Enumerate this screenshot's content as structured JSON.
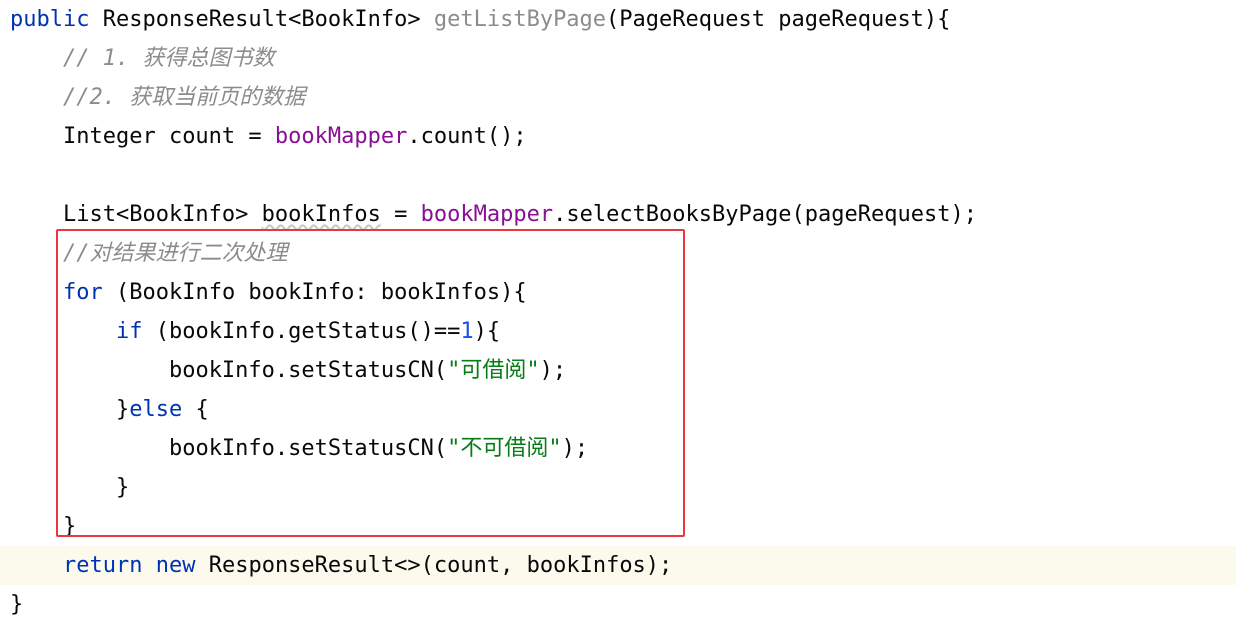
{
  "code": {
    "lines": [
      {
        "indent": "",
        "tokens": [
          {
            "t": "public",
            "c": "kw"
          },
          {
            "t": " ResponseResult<BookInfo> ",
            "c": ""
          },
          {
            "t": "getListByPage",
            "c": "fn"
          },
          {
            "t": "(PageRequest pageRequest){",
            "c": ""
          }
        ]
      },
      {
        "indent": "    ",
        "tokens": [
          {
            "t": "// 1. 获得总图书数",
            "c": "cm"
          }
        ]
      },
      {
        "indent": "    ",
        "tokens": [
          {
            "t": "//2. 获取当前页的数据",
            "c": "cm"
          }
        ]
      },
      {
        "indent": "    ",
        "tokens": [
          {
            "t": "Integer count = ",
            "c": ""
          },
          {
            "t": "bookMapper",
            "c": "field"
          },
          {
            "t": ".count();",
            "c": ""
          }
        ]
      },
      {
        "indent": "",
        "tokens": []
      },
      {
        "indent": "    ",
        "tokens": [
          {
            "t": "List<BookInfo> ",
            "c": ""
          },
          {
            "t": "bookInfos",
            "c": "warn"
          },
          {
            "t": " = ",
            "c": ""
          },
          {
            "t": "bookMapper",
            "c": "field"
          },
          {
            "t": ".selectBooksByPage(pageRequest);",
            "c": ""
          }
        ]
      },
      {
        "indent": "    ",
        "tokens": [
          {
            "t": "//对结果进行二次处理",
            "c": "cm"
          }
        ]
      },
      {
        "indent": "    ",
        "tokens": [
          {
            "t": "for",
            "c": "kw"
          },
          {
            "t": " (BookInfo bookInfo: bookInfos){",
            "c": ""
          }
        ]
      },
      {
        "indent": "        ",
        "tokens": [
          {
            "t": "if",
            "c": "kw"
          },
          {
            "t": " (bookInfo.getStatus()==",
            "c": ""
          },
          {
            "t": "1",
            "c": "num"
          },
          {
            "t": "){",
            "c": ""
          }
        ]
      },
      {
        "indent": "            ",
        "tokens": [
          {
            "t": "bookInfo.setStatusCN(",
            "c": ""
          },
          {
            "t": "\"可借阅\"",
            "c": "str"
          },
          {
            "t": ");",
            "c": ""
          }
        ]
      },
      {
        "indent": "        ",
        "tokens": [
          {
            "t": "}",
            "c": ""
          },
          {
            "t": "else",
            "c": "kw"
          },
          {
            "t": " {",
            "c": ""
          }
        ]
      },
      {
        "indent": "            ",
        "tokens": [
          {
            "t": "bookInfo.setStatusCN(",
            "c": ""
          },
          {
            "t": "\"不可借阅\"",
            "c": "str"
          },
          {
            "t": ");",
            "c": ""
          }
        ]
      },
      {
        "indent": "        ",
        "tokens": [
          {
            "t": "}",
            "c": ""
          }
        ]
      },
      {
        "indent": "    ",
        "tokens": [
          {
            "t": "}",
            "c": ""
          }
        ]
      },
      {
        "indent": "    ",
        "tokens": [
          {
            "t": "return",
            "c": "kw"
          },
          {
            "t": " ",
            "c": ""
          },
          {
            "t": "new",
            "c": "kw"
          },
          {
            "t": " ResponseResult<>(count, bookInfos);",
            "c": ""
          }
        ],
        "current": true
      },
      {
        "indent": "",
        "tokens": [
          {
            "t": "}",
            "c": ""
          }
        ]
      }
    ]
  },
  "colors": {
    "keyword": "#0033b3",
    "unused_method": "#8c8c8c",
    "field": "#871094",
    "comment": "#8c8c8c",
    "string": "#067d17",
    "number": "#1750eb",
    "highlight_box": "#e8383d",
    "current_line": "#fcfaed"
  }
}
